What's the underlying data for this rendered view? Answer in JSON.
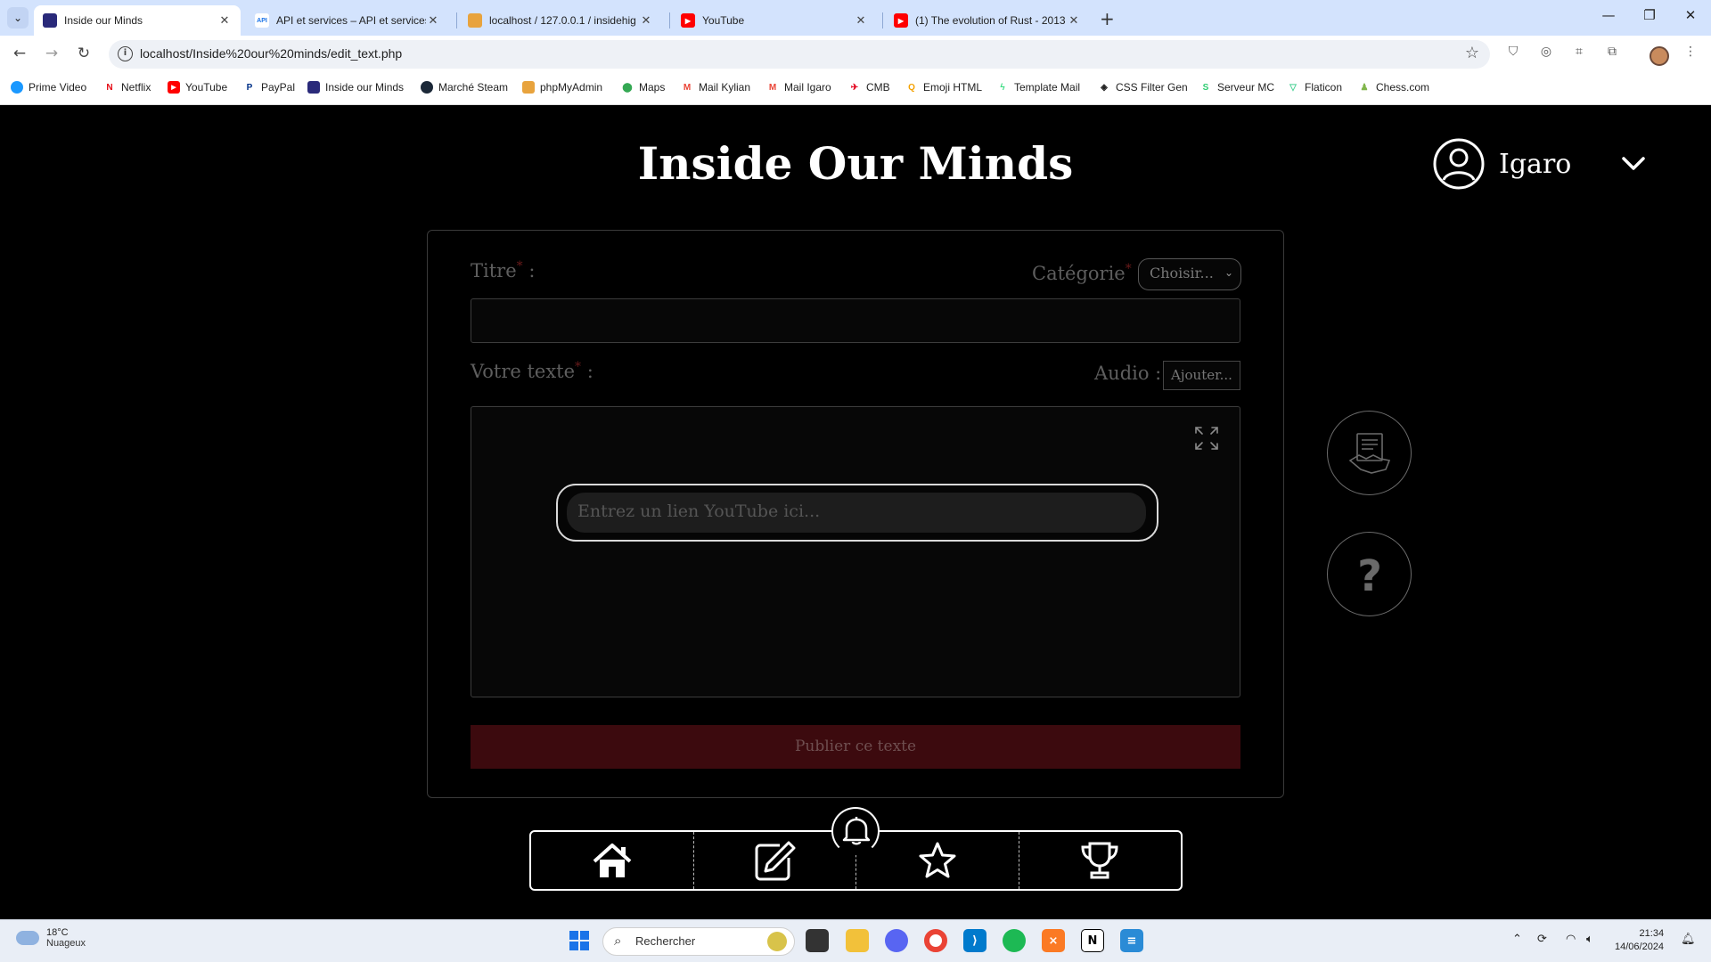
{
  "browser": {
    "tabs": [
      {
        "title": "Inside our Minds",
        "favicon": "site-icon",
        "active": true
      },
      {
        "title": "API et services – API et services",
        "favicon": "api-icon",
        "active": false
      },
      {
        "title": "localhost / 127.0.0.1 / insidehig",
        "favicon": "phpmyadmin-icon",
        "active": false
      },
      {
        "title": "YouTube",
        "favicon": "youtube-icon",
        "active": false
      },
      {
        "title": "(1) The evolution of Rust - 2013",
        "favicon": "youtube-icon",
        "active": false
      }
    ],
    "url": "localhost/Inside%20our%20minds/edit_text.php",
    "bookmarks": [
      {
        "label": "Prime Video",
        "icon": "prime-video-icon",
        "color": "#1a98ff"
      },
      {
        "label": "Netflix",
        "icon": "netflix-icon",
        "color": "#e50914"
      },
      {
        "label": "YouTube",
        "icon": "youtube-icon",
        "color": "#ff0000"
      },
      {
        "label": "PayPal",
        "icon": "paypal-icon",
        "color": "#003087"
      },
      {
        "label": "Inside our Minds",
        "icon": "site-icon",
        "color": "#2a2a7a"
      },
      {
        "label": "Marché Steam",
        "icon": "steam-icon",
        "color": "#1b2838"
      },
      {
        "label": "phpMyAdmin",
        "icon": "phpmyadmin-icon",
        "color": "#e8a33d"
      },
      {
        "label": "Maps",
        "icon": "maps-icon",
        "color": "#34a853"
      },
      {
        "label": "Mail Kylian",
        "icon": "gmail-icon",
        "color": "#ea4335"
      },
      {
        "label": "Mail Igaro",
        "icon": "gmail-icon",
        "color": "#ea4335"
      },
      {
        "label": "CMB",
        "icon": "cmb-icon",
        "color": "#e2001a"
      },
      {
        "label": "Emoji HTML",
        "icon": "search-icon",
        "color": "#f4a100"
      },
      {
        "label": "Template Mail",
        "icon": "bolt-icon",
        "color": "#3ddc84"
      },
      {
        "label": "CSS Filter Gen",
        "icon": "diamond-icon",
        "color": "#222222"
      },
      {
        "label": "Serveur MC",
        "icon": "s-icon",
        "color": "#2ecc71"
      },
      {
        "label": "Flaticon",
        "icon": "flaticon-icon",
        "color": "#4ad295"
      },
      {
        "label": "Chess.com",
        "icon": "pawn-icon",
        "color": "#81b64c"
      }
    ]
  },
  "site": {
    "title": "Inside Our Minds",
    "username": "Igaro"
  },
  "form": {
    "title_label": "Titre",
    "category_label": "Catégorie",
    "category_value": "Choisir...",
    "text_label": "Votre texte",
    "audio_label": "Audio :",
    "audio_button": "Ajouter...",
    "youtube_placeholder": "Entrez un lien YouTube ici...",
    "publish_button": "Publier ce texte",
    "colon": ":"
  },
  "taskbar": {
    "temperature": "18°C",
    "weather": "Nuageux",
    "search_placeholder": "Rechercher",
    "time": "21:34",
    "date": "14/06/2024"
  }
}
